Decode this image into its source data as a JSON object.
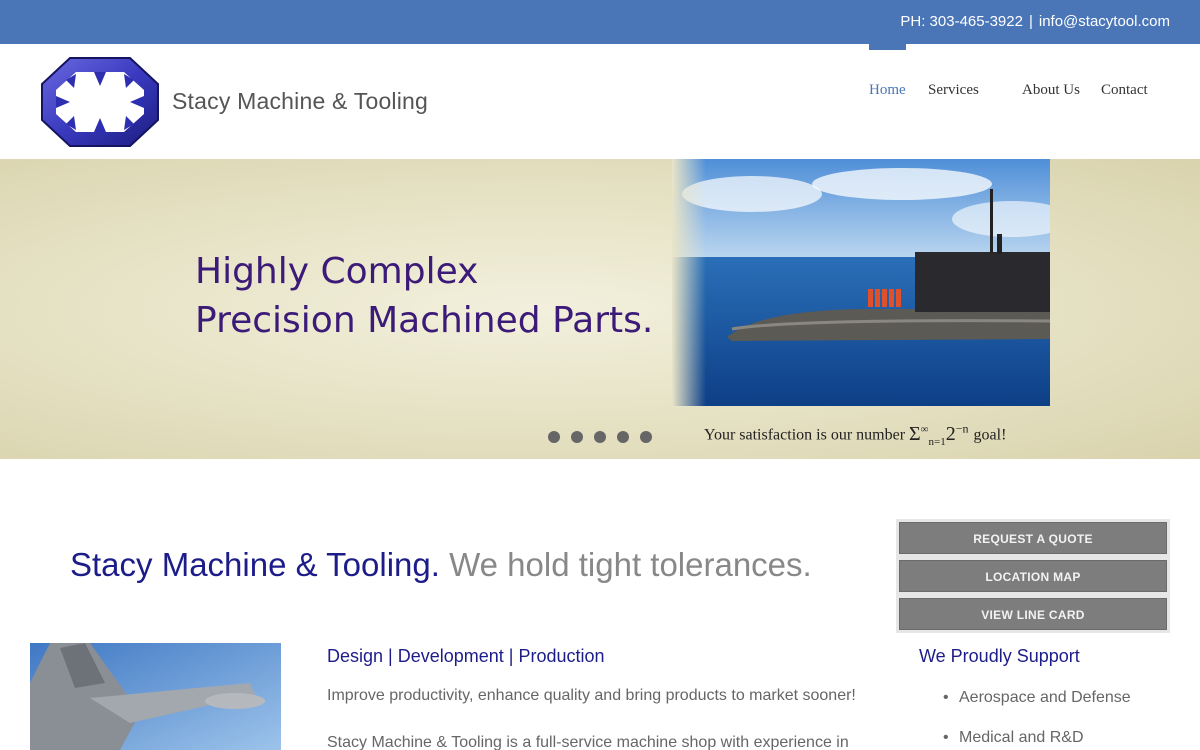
{
  "topbar": {
    "phone": "PH: 303-465-3922",
    "separator": "|",
    "email": "info@stacytool.com",
    "bg_color": "#4a76b8"
  },
  "header": {
    "brand": "Stacy Machine & Tooling",
    "nav": [
      {
        "label": "Home",
        "active": true
      },
      {
        "label": "Services",
        "active": false
      },
      {
        "label": "About Us",
        "active": false
      },
      {
        "label": "Contact",
        "active": false
      }
    ]
  },
  "hero": {
    "title_line1": "Highly Complex",
    "title_line2": "Precision Machined Parts.",
    "caption_prefix": "Your satisfaction is our number",
    "caption_suffix": "goal!",
    "slide_count": 5,
    "title_color": "#3c1a78"
  },
  "main": {
    "headline_primary": "Stacy Machine & Tooling.",
    "headline_secondary": "We hold tight tolerances.",
    "side_buttons": [
      "REQUEST A QUOTE",
      "LOCATION MAP",
      "VIEW LINE CARD"
    ],
    "section_title": "Design | Development | Production",
    "intro": "Improve productivity, enhance quality and bring products to market sooner!",
    "body": "Stacy Machine & Tooling is a full-service machine shop with experience in",
    "support_title": "We Proudly Support",
    "support_items": [
      "Aerospace and Defense",
      "Medical and R&D"
    ]
  }
}
